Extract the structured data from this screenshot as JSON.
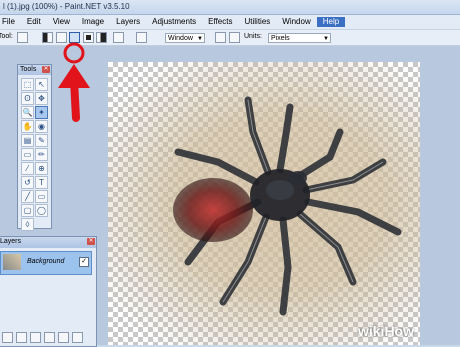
{
  "window": {
    "title": "l (1).jpg (100%) - Paint.NET v3.5.10"
  },
  "menu": [
    "File",
    "Edit",
    "View",
    "Image",
    "Layers",
    "Adjustments",
    "Effects",
    "Utilities",
    "Window",
    "Help"
  ],
  "toolbar": {
    "tool_label": "Tool:",
    "sampling_value": "Window",
    "units_label": "Units:",
    "units_value": "Pixels"
  },
  "tools_panel": {
    "title": "Tools",
    "icons": [
      "rect-select-icon",
      "move-selection-icon",
      "lasso-icon",
      "move-icon",
      "zoom-icon",
      "magic-wand-icon",
      "pan-icon",
      "bucket-icon",
      "gradient-icon",
      "paintbrush-icon",
      "eraser-icon",
      "pencil-icon",
      "color-picker-icon",
      "clone-stamp-icon",
      "recolor-icon",
      "text-icon",
      "line-icon",
      "rectangle-icon",
      "rounded-rect-icon",
      "ellipse-icon",
      "freeform-icon"
    ]
  },
  "layers_panel": {
    "title": "Layers",
    "layer_name": "Background"
  },
  "watermark": "wikiHow",
  "colors": {
    "accent": "#3b6fc4",
    "arrow": "#e0141a"
  }
}
